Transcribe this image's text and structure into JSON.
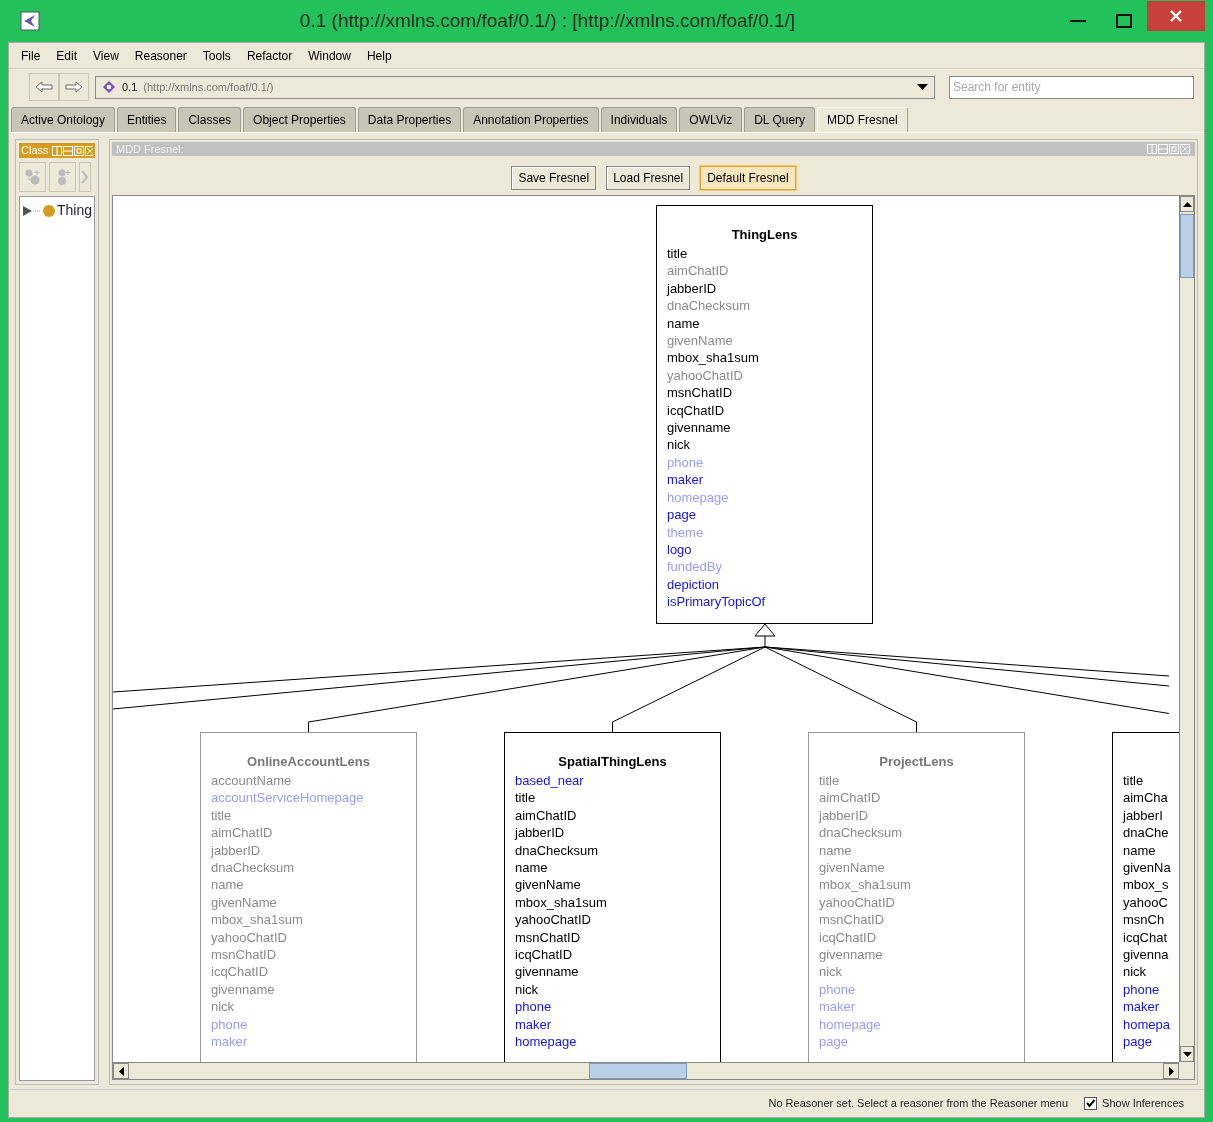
{
  "window": {
    "title": "0.1 (http://xmlns.com/foaf/0.1/)  : [http://xmlns.com/foaf/0.1/]"
  },
  "menu": [
    "File",
    "Edit",
    "View",
    "Reasoner",
    "Tools",
    "Refactor",
    "Window",
    "Help"
  ],
  "address": {
    "name": "0.1",
    "iri": "(http://xmlns.com/foaf/0.1/)"
  },
  "search": {
    "placeholder": "Search for entity"
  },
  "tabs": [
    {
      "label": "Active Ontology",
      "selected": false
    },
    {
      "label": "Entities",
      "selected": false
    },
    {
      "label": "Classes",
      "selected": false
    },
    {
      "label": "Object Properties",
      "selected": false
    },
    {
      "label": "Data Properties",
      "selected": false
    },
    {
      "label": "Annotation Properties",
      "selected": false
    },
    {
      "label": "Individuals",
      "selected": false
    },
    {
      "label": "OWLViz",
      "selected": false
    },
    {
      "label": "DL Query",
      "selected": false
    },
    {
      "label": "MDD Fresnel",
      "selected": true
    }
  ],
  "class_panel": {
    "title": "Class",
    "tree": [
      {
        "label": "Thing",
        "expanded": false
      }
    ]
  },
  "fresnel_panel": {
    "title": "MDD Fresnel:",
    "buttons": [
      {
        "label": "Save Fresnel",
        "focused": false
      },
      {
        "label": "Load Fresnel",
        "focused": false
      },
      {
        "label": "Default Fresnel",
        "focused": true
      }
    ],
    "lenses": [
      {
        "title": "ThingLens",
        "enabled": true,
        "properties": [
          {
            "name": "title",
            "kind": "data",
            "enabled": true
          },
          {
            "name": "aimChatID",
            "kind": "data",
            "enabled": false
          },
          {
            "name": "jabberID",
            "kind": "data",
            "enabled": true
          },
          {
            "name": "dnaChecksum",
            "kind": "data",
            "enabled": false
          },
          {
            "name": "name",
            "kind": "data",
            "enabled": true
          },
          {
            "name": "givenName",
            "kind": "data",
            "enabled": false
          },
          {
            "name": "mbox_sha1sum",
            "kind": "data",
            "enabled": true
          },
          {
            "name": "yahooChatID",
            "kind": "data",
            "enabled": false
          },
          {
            "name": "msnChatID",
            "kind": "data",
            "enabled": true
          },
          {
            "name": "icqChatID",
            "kind": "data",
            "enabled": true
          },
          {
            "name": "givenname",
            "kind": "data",
            "enabled": true
          },
          {
            "name": "nick",
            "kind": "data",
            "enabled": true
          },
          {
            "name": "phone",
            "kind": "object",
            "enabled": false
          },
          {
            "name": "maker",
            "kind": "object",
            "enabled": true
          },
          {
            "name": "homepage",
            "kind": "object",
            "enabled": false
          },
          {
            "name": "page",
            "kind": "object",
            "enabled": true
          },
          {
            "name": "theme",
            "kind": "object",
            "enabled": false
          },
          {
            "name": "logo",
            "kind": "object",
            "enabled": true
          },
          {
            "name": "fundedBy",
            "kind": "object",
            "enabled": false
          },
          {
            "name": "depiction",
            "kind": "object",
            "enabled": true
          },
          {
            "name": "isPrimaryTopicOf",
            "kind": "object",
            "enabled": true
          }
        ]
      },
      {
        "title": "OnlineAccountLens",
        "enabled": false,
        "properties": [
          {
            "name": "accountName",
            "kind": "data",
            "enabled": false
          },
          {
            "name": "accountServiceHomepage",
            "kind": "object",
            "enabled": false
          },
          {
            "name": "title",
            "kind": "data",
            "enabled": false
          },
          {
            "name": "aimChatID",
            "kind": "data",
            "enabled": false
          },
          {
            "name": "jabberID",
            "kind": "data",
            "enabled": false
          },
          {
            "name": "dnaChecksum",
            "kind": "data",
            "enabled": false
          },
          {
            "name": "name",
            "kind": "data",
            "enabled": false
          },
          {
            "name": "givenName",
            "kind": "data",
            "enabled": false
          },
          {
            "name": "mbox_sha1sum",
            "kind": "data",
            "enabled": false
          },
          {
            "name": "yahooChatID",
            "kind": "data",
            "enabled": false
          },
          {
            "name": "msnChatID",
            "kind": "data",
            "enabled": false
          },
          {
            "name": "icqChatID",
            "kind": "data",
            "enabled": false
          },
          {
            "name": "givenname",
            "kind": "data",
            "enabled": false
          },
          {
            "name": "nick",
            "kind": "data",
            "enabled": false
          },
          {
            "name": "phone",
            "kind": "object",
            "enabled": false
          },
          {
            "name": "maker",
            "kind": "object",
            "enabled": false
          }
        ]
      },
      {
        "title": "SpatialThingLens",
        "enabled": true,
        "properties": [
          {
            "name": "based_near",
            "kind": "object",
            "enabled": true
          },
          {
            "name": "title",
            "kind": "data",
            "enabled": true
          },
          {
            "name": "aimChatID",
            "kind": "data",
            "enabled": true
          },
          {
            "name": "jabberID",
            "kind": "data",
            "enabled": true
          },
          {
            "name": "dnaChecksum",
            "kind": "data",
            "enabled": true
          },
          {
            "name": "name",
            "kind": "data",
            "enabled": true
          },
          {
            "name": "givenName",
            "kind": "data",
            "enabled": true
          },
          {
            "name": "mbox_sha1sum",
            "kind": "data",
            "enabled": true
          },
          {
            "name": "yahooChatID",
            "kind": "data",
            "enabled": true
          },
          {
            "name": "msnChatID",
            "kind": "data",
            "enabled": true
          },
          {
            "name": "icqChatID",
            "kind": "data",
            "enabled": true
          },
          {
            "name": "givenname",
            "kind": "data",
            "enabled": true
          },
          {
            "name": "nick",
            "kind": "data",
            "enabled": true
          },
          {
            "name": "phone",
            "kind": "object",
            "enabled": true
          },
          {
            "name": "maker",
            "kind": "object",
            "enabled": true
          },
          {
            "name": "homepage",
            "kind": "object",
            "enabled": true
          }
        ]
      },
      {
        "title": "ProjectLens",
        "enabled": false,
        "properties": [
          {
            "name": "title",
            "kind": "data",
            "enabled": false
          },
          {
            "name": "aimChatID",
            "kind": "data",
            "enabled": false
          },
          {
            "name": "jabberID",
            "kind": "data",
            "enabled": false
          },
          {
            "name": "dnaChecksum",
            "kind": "data",
            "enabled": false
          },
          {
            "name": "name",
            "kind": "data",
            "enabled": false
          },
          {
            "name": "givenName",
            "kind": "data",
            "enabled": false
          },
          {
            "name": "mbox_sha1sum",
            "kind": "data",
            "enabled": false
          },
          {
            "name": "yahooChatID",
            "kind": "data",
            "enabled": false
          },
          {
            "name": "msnChatID",
            "kind": "data",
            "enabled": false
          },
          {
            "name": "icqChatID",
            "kind": "data",
            "enabled": false
          },
          {
            "name": "givenname",
            "kind": "data",
            "enabled": false
          },
          {
            "name": "nick",
            "kind": "data",
            "enabled": false
          },
          {
            "name": "phone",
            "kind": "object",
            "enabled": false
          },
          {
            "name": "maker",
            "kind": "object",
            "enabled": false
          },
          {
            "name": "homepage",
            "kind": "object",
            "enabled": false
          },
          {
            "name": "page",
            "kind": "object",
            "enabled": false
          }
        ]
      },
      {
        "enabled": true,
        "properties": [
          {
            "name": "title",
            "kind": "data",
            "enabled": true
          },
          {
            "name": "aimCha",
            "kind": "data",
            "enabled": true
          },
          {
            "name": "jabberI",
            "kind": "data",
            "enabled": true
          },
          {
            "name": "dnaChe",
            "kind": "data",
            "enabled": true
          },
          {
            "name": "name",
            "kind": "data",
            "enabled": true
          },
          {
            "name": "givenNa",
            "kind": "data",
            "enabled": true
          },
          {
            "name": "mbox_s",
            "kind": "data",
            "enabled": true
          },
          {
            "name": "yahooC",
            "kind": "data",
            "enabled": true
          },
          {
            "name": "msnCh",
            "kind": "data",
            "enabled": true
          },
          {
            "name": "icqChat",
            "kind": "data",
            "enabled": true
          },
          {
            "name": "givenna",
            "kind": "data",
            "enabled": true
          },
          {
            "name": "nick",
            "kind": "data",
            "enabled": true
          },
          {
            "name": "phone",
            "kind": "object",
            "enabled": true
          },
          {
            "name": "maker",
            "kind": "object",
            "enabled": true
          },
          {
            "name": "homepa",
            "kind": "object",
            "enabled": true
          },
          {
            "name": "page",
            "kind": "object",
            "enabled": true
          }
        ]
      }
    ]
  },
  "status_bar": {
    "message": "No Reasoner set. Select a reasoner from the Reasoner menu",
    "show_inferences": {
      "label": "Show Inferences",
      "checked": true
    }
  }
}
